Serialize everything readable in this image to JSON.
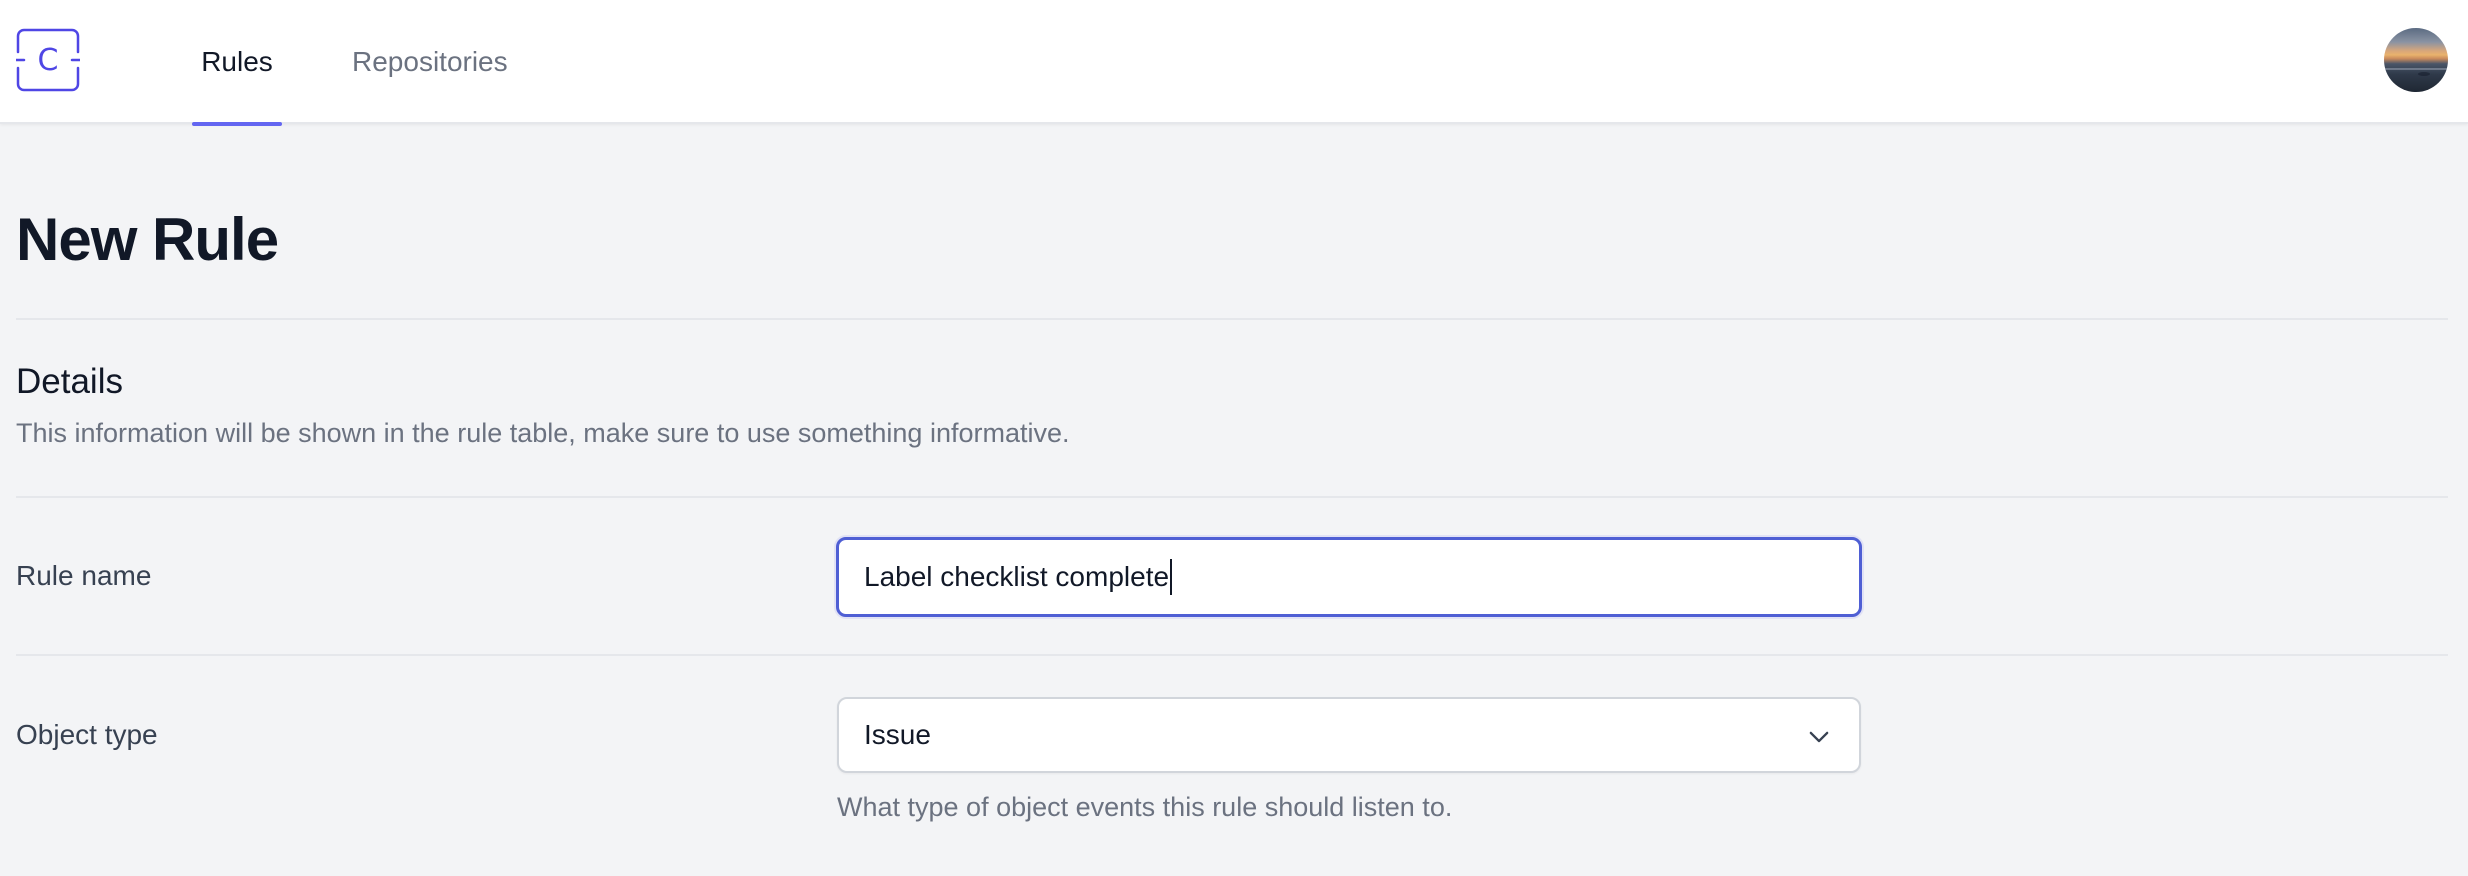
{
  "app": {
    "logo_letter": "C",
    "brand_color": "#4f46e5"
  },
  "nav": {
    "tabs": [
      {
        "label": "Rules",
        "active": true
      },
      {
        "label": "Repositories",
        "active": false
      }
    ],
    "avatar_icon": "user-avatar-photo"
  },
  "page": {
    "title": "New Rule"
  },
  "details": {
    "title": "Details",
    "description": "This information will be shown in the rule table, make sure to use something informative."
  },
  "form": {
    "rule_name": {
      "label": "Rule name",
      "value": "Label checklist complete",
      "focused": true
    },
    "object_type": {
      "label": "Object type",
      "selected": "Issue",
      "help": "What type of object events this rule should listen to.",
      "icon": "chevron-down-icon"
    }
  },
  "colors": {
    "accent": "#6366f1",
    "focus_ring": "#4f5fd4",
    "page_background": "#f3f4f6",
    "muted_text": "#6b7280"
  }
}
